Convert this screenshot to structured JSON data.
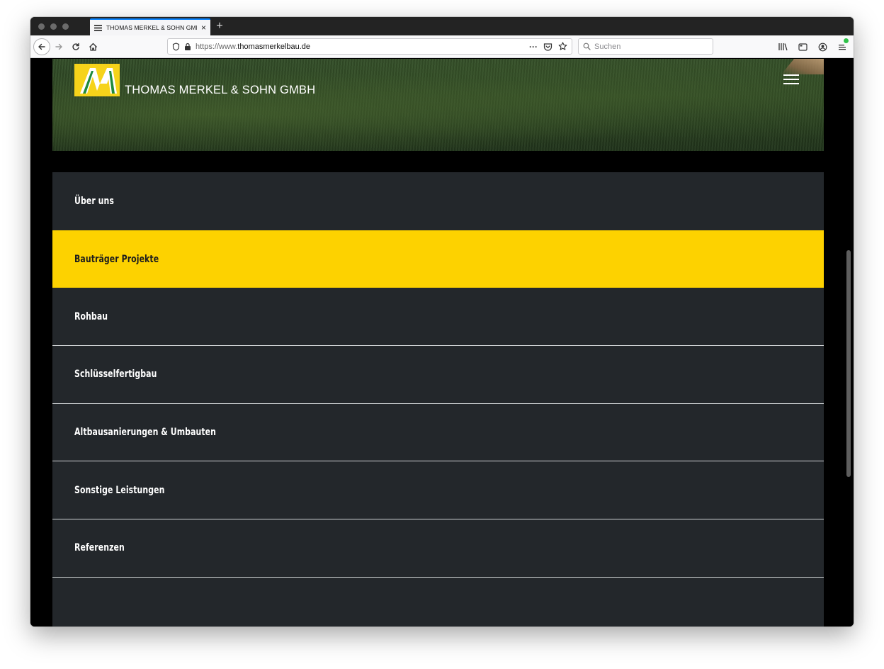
{
  "browser": {
    "tab_title": "THOMAS MERKEL & SOHN GMBH",
    "tab_close": "×",
    "new_tab": "+",
    "url_prefix": "https://www.",
    "url_domain": "thomasmerkelbau.de",
    "url_more": "···",
    "search_placeholder": "Suchen",
    "accent_color": "#0a84ff"
  },
  "site": {
    "brand": "THOMAS MERKEL & SOHN GMBH",
    "brand_color": "#f6d31a",
    "active_color": "#fdd200",
    "menu_bg": "#23272b"
  },
  "menu": {
    "items": [
      {
        "label": "Über uns",
        "active": false
      },
      {
        "label": "Bauträger Projekte",
        "active": true
      },
      {
        "label": "Rohbau",
        "active": false
      },
      {
        "label": "Schlüsselfertigbau",
        "active": false
      },
      {
        "label": "Altbausanierungen & Umbauten",
        "active": false
      },
      {
        "label": "Sonstige Leistungen",
        "active": false
      },
      {
        "label": "Referenzen",
        "active": false
      }
    ]
  }
}
